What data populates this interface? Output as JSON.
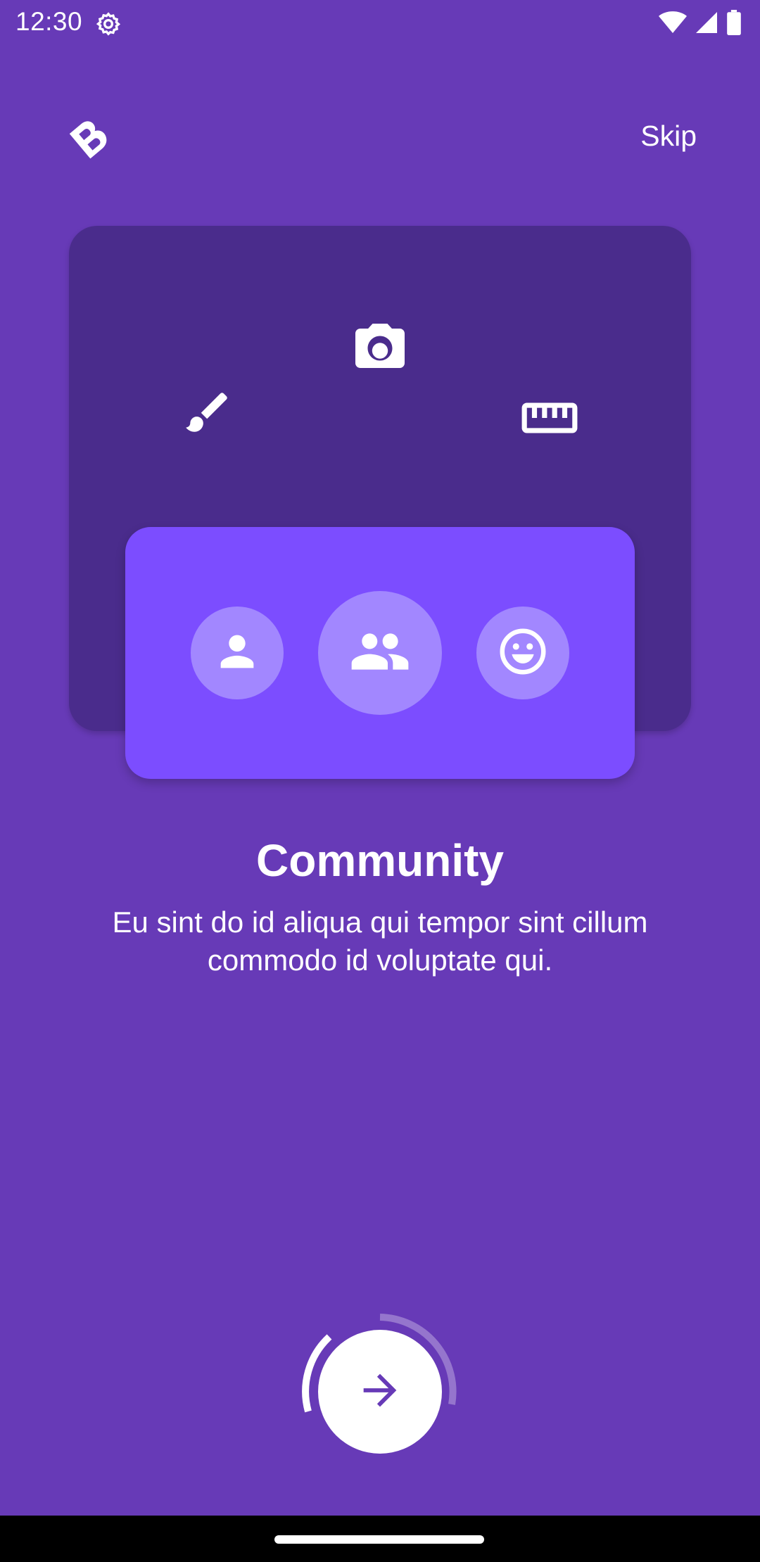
{
  "status_bar": {
    "time": "12:30",
    "icons": [
      "settings-icon",
      "wifi-icon",
      "signal-icon",
      "battery-icon"
    ]
  },
  "header": {
    "logo_icon": "b-logo-icon",
    "skip_label": "Skip"
  },
  "illustration": {
    "top_icons": [
      "brush-icon",
      "camera-icon",
      "ruler-icon"
    ],
    "community_icons": [
      "person-icon",
      "people-icon",
      "smiley-icon"
    ]
  },
  "content": {
    "title": "Community",
    "description": "Eu sint do id aliqua qui tempor sint cillum commodo id voluptate qui."
  },
  "next_button": {
    "icon": "arrow-right-icon"
  },
  "colors": {
    "background": "#673AB7",
    "back_card": "#4A2C8C",
    "front_card": "#7C4DFF",
    "circle": "#A287FF",
    "button": "#FFFFFF",
    "arrow": "#673AB7"
  }
}
